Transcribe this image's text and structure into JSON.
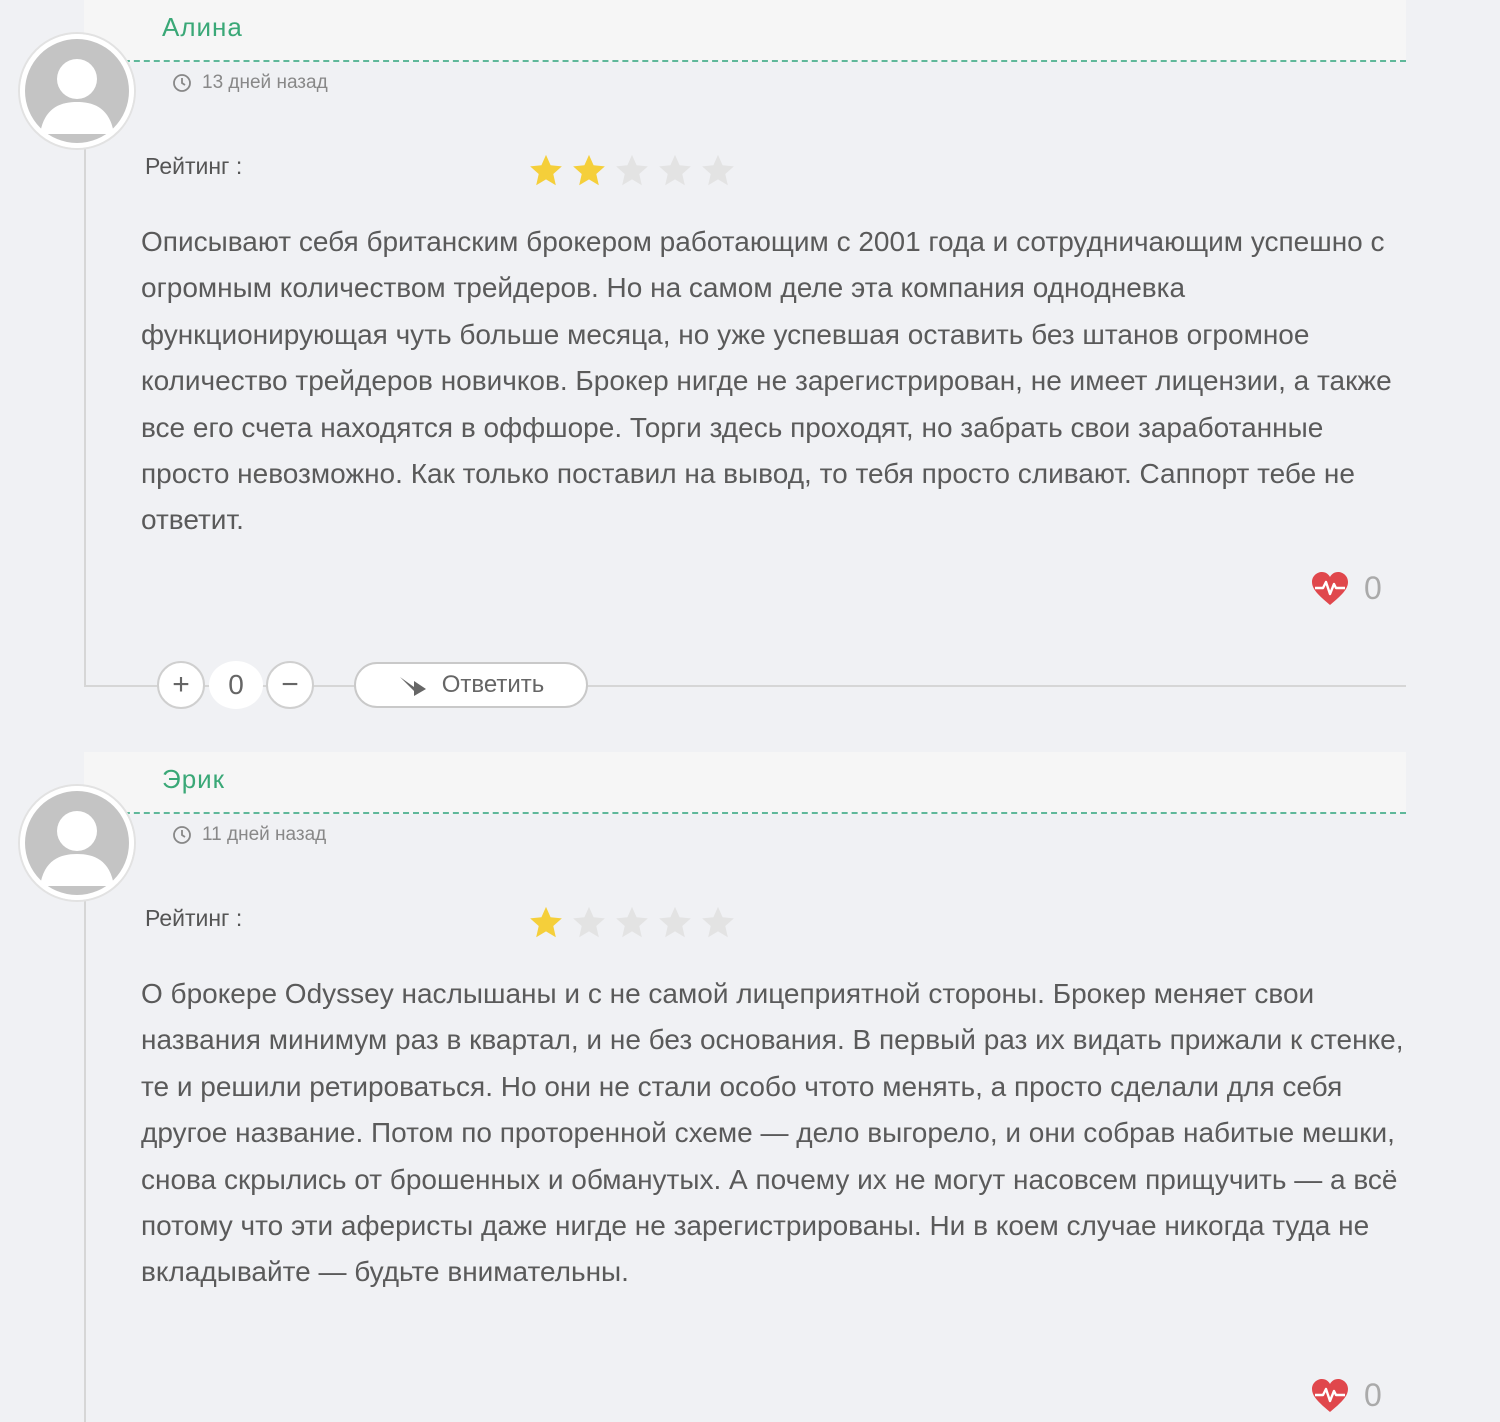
{
  "comments": [
    {
      "author": "Алина",
      "date": "13 дней назад",
      "rating_label": "Рейтинг :",
      "rating": 2,
      "rating_max": 5,
      "text": "Описывают себя британским брокером работающим с 2001 года и сотрудничающим успешно с огромным количеством трейдеров. Но на самом деле эта компания однодневка функционирующая чуть больше месяца, но уже успевшая оставить без штанов огромное количество трейдеров новичков. Брокер нигде не зарегистрирован, не имеет лицензии, а также все его счета находятся в оффшоре. Торги здесь проходят, но забрать свои заработанные просто невозможно. Как только поставил на вывод, то тебя просто сливают. Саппорт тебе не ответит.",
      "likes": "0",
      "vote_plus": "+",
      "vote_count": "0",
      "vote_minus": "−",
      "reply_label": "Ответить"
    },
    {
      "author": "Эрик",
      "date": "11 дней назад",
      "rating_label": "Рейтинг :",
      "rating": 1,
      "rating_max": 5,
      "text": "О брокере Odyssey наслышаны и с не самой лицеприятной стороны. Брокер меняет свои названия минимум раз в квартал, и не без основания. В первый раз их видать прижали к стенке, те и решили ретироваться. Но они не стали особо чтото менять, а просто сделали для себя другое название. Потом по проторенной схеме — дело выгорело, и они собрав набитые мешки, снова скрылись от брошенных и обманутых. А почему их не могут насовсем прищучить — а всё потому что эти аферисты даже нигде не зарегистрированы. Ни в коем случае никогда туда не вкладывайте — будьте внимательны.",
      "likes": "0"
    }
  ],
  "colors": {
    "accent": "#3aa877",
    "star_active": "#f5cf3a",
    "star_inactive": "#e3e3e3",
    "heart": "#e0474c"
  },
  "icons": {
    "avatar": "user-silhouette-icon",
    "clock": "clock-icon",
    "star": "star-icon",
    "like": "heartbeat-icon",
    "reply": "reply-arrow-icon"
  }
}
